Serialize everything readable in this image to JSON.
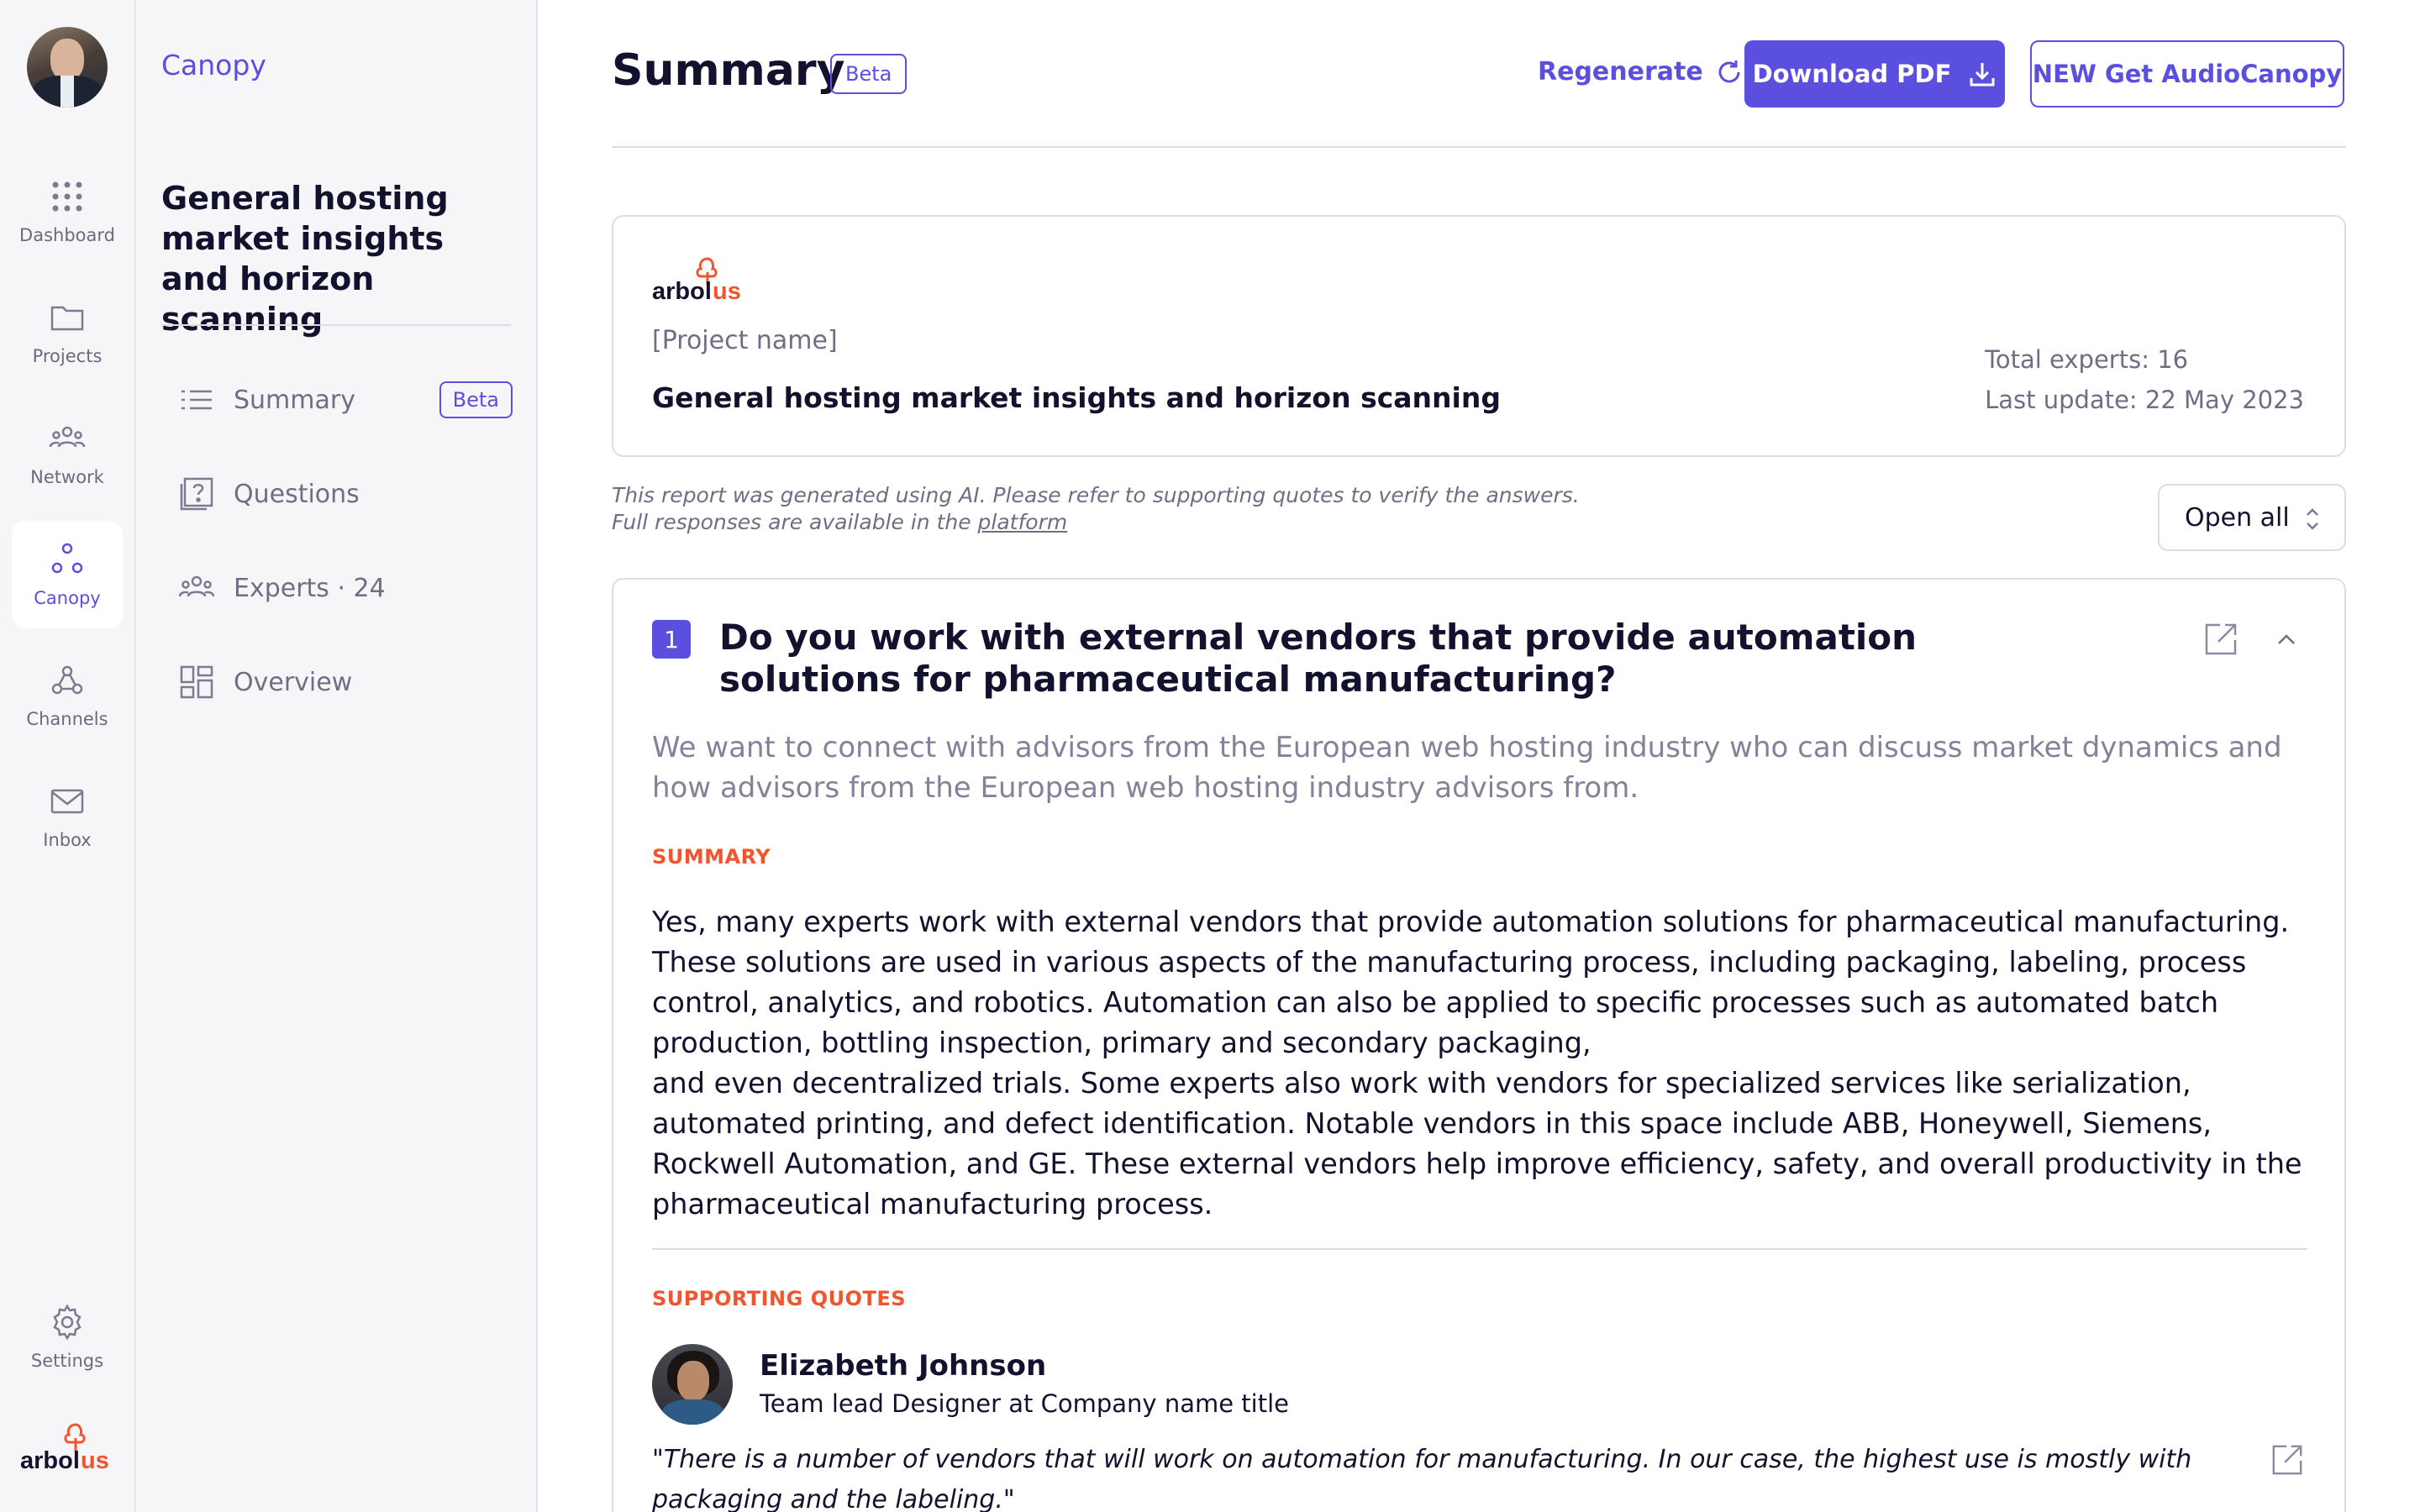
{
  "rail": {
    "items": [
      {
        "label": "Dashboard",
        "icon": "grid-dots-icon"
      },
      {
        "label": "Projects",
        "icon": "folder-icon"
      },
      {
        "label": "Network",
        "icon": "people-group-icon"
      },
      {
        "label": "Canopy",
        "icon": "canopy-nodes-icon"
      },
      {
        "label": "Channels",
        "icon": "webhook-icon"
      },
      {
        "label": "Inbox",
        "icon": "envelope-icon"
      }
    ],
    "active": "Canopy",
    "settings_label": "Settings",
    "logo_text": "arbolus"
  },
  "sidebar": {
    "brand": "Canopy",
    "project_title": "General hosting market insights and horizon scanning",
    "nav": [
      {
        "label": "Summary",
        "badge": "Beta",
        "icon": "list-icon"
      },
      {
        "label": "Questions",
        "icon": "question-doc-icon"
      },
      {
        "label": "Experts · 24",
        "icon": "people-group-icon"
      },
      {
        "label": "Overview",
        "icon": "layout-grid-icon"
      }
    ]
  },
  "header": {
    "title": "Summary",
    "badge": "Beta",
    "regenerate_label": "Regenerate",
    "download_label": "Download PDF",
    "audio_label": "NEW Get AudioCanopy"
  },
  "project_card": {
    "logo_text": "arbolus",
    "label": "[Project name]",
    "name": "General hosting market insights and horizon scanning",
    "total_experts": "Total experts: 16",
    "last_update": "Last update: 22 May 2023"
  },
  "disclaimer": {
    "line1": "This report was generated using AI. Please refer to supporting quotes to verify the answers.",
    "line2_prefix": "Full responses are available in the ",
    "link": "platform"
  },
  "open_all_label": "Open all",
  "question": {
    "number": "1",
    "text": "Do you work with external vendors that provide automation solutions for pharmaceutical manufacturing?",
    "description": "We want to connect with advisors from the European web hosting industry who can discuss market dynamics and how advisors from the European web hosting industry advisors from.",
    "summary_label": "SUMMARY",
    "summary_p1": "Yes, many experts work with external vendors that provide automation solutions for pharmaceutical manufacturing. These solutions are used in various aspects of the manufacturing process, including packaging, labeling, process control, analytics, and robotics. Automation can also be applied to specific processes such as automated batch production, bottling inspection, primary and secondary packaging,",
    "summary_p2": "and even decentralized trials. Some experts also work with vendors for specialized services like serialization, automated printing, and defect identification. Notable vendors in this space include ABB, Honeywell, Siemens, Rockwell Automation, and GE. These external vendors help improve efficiency, safety, and overall productivity in the pharmaceutical manufacturing process.",
    "quotes_label": "SUPPORTING QUOTES",
    "quote": {
      "expert_name": "Elizabeth Johnson",
      "expert_role": "Team lead Designer at Company name title",
      "text": "\"There is a number of vendors that will work on automation for manufacturing. In our case, the highest use is mostly with packaging and the labeling.\""
    }
  },
  "colors": {
    "accent": "#5b4fe0",
    "label_orange": "#f0552e",
    "text_dark": "#12122e",
    "text_muted": "#6e6e84"
  }
}
